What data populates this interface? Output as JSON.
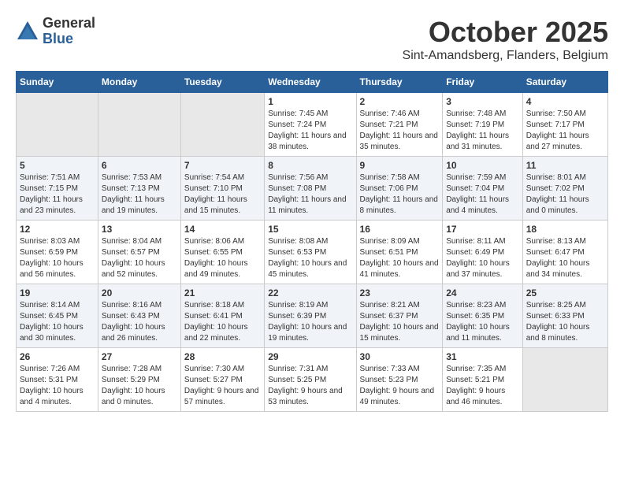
{
  "logo": {
    "general": "General",
    "blue": "Blue"
  },
  "header": {
    "month": "October 2025",
    "location": "Sint-Amandsberg, Flanders, Belgium"
  },
  "weekdays": [
    "Sunday",
    "Monday",
    "Tuesday",
    "Wednesday",
    "Thursday",
    "Friday",
    "Saturday"
  ],
  "weeks": [
    [
      {
        "day": "",
        "empty": true
      },
      {
        "day": "",
        "empty": true
      },
      {
        "day": "",
        "empty": true
      },
      {
        "day": "1",
        "sunrise": "7:45 AM",
        "sunset": "7:24 PM",
        "daylight": "11 hours and 38 minutes."
      },
      {
        "day": "2",
        "sunrise": "7:46 AM",
        "sunset": "7:21 PM",
        "daylight": "11 hours and 35 minutes."
      },
      {
        "day": "3",
        "sunrise": "7:48 AM",
        "sunset": "7:19 PM",
        "daylight": "11 hours and 31 minutes."
      },
      {
        "day": "4",
        "sunrise": "7:50 AM",
        "sunset": "7:17 PM",
        "daylight": "11 hours and 27 minutes."
      }
    ],
    [
      {
        "day": "5",
        "sunrise": "7:51 AM",
        "sunset": "7:15 PM",
        "daylight": "11 hours and 23 minutes."
      },
      {
        "day": "6",
        "sunrise": "7:53 AM",
        "sunset": "7:13 PM",
        "daylight": "11 hours and 19 minutes."
      },
      {
        "day": "7",
        "sunrise": "7:54 AM",
        "sunset": "7:10 PM",
        "daylight": "11 hours and 15 minutes."
      },
      {
        "day": "8",
        "sunrise": "7:56 AM",
        "sunset": "7:08 PM",
        "daylight": "11 hours and 11 minutes."
      },
      {
        "day": "9",
        "sunrise": "7:58 AM",
        "sunset": "7:06 PM",
        "daylight": "11 hours and 8 minutes."
      },
      {
        "day": "10",
        "sunrise": "7:59 AM",
        "sunset": "7:04 PM",
        "daylight": "11 hours and 4 minutes."
      },
      {
        "day": "11",
        "sunrise": "8:01 AM",
        "sunset": "7:02 PM",
        "daylight": "11 hours and 0 minutes."
      }
    ],
    [
      {
        "day": "12",
        "sunrise": "8:03 AM",
        "sunset": "6:59 PM",
        "daylight": "10 hours and 56 minutes."
      },
      {
        "day": "13",
        "sunrise": "8:04 AM",
        "sunset": "6:57 PM",
        "daylight": "10 hours and 52 minutes."
      },
      {
        "day": "14",
        "sunrise": "8:06 AM",
        "sunset": "6:55 PM",
        "daylight": "10 hours and 49 minutes."
      },
      {
        "day": "15",
        "sunrise": "8:08 AM",
        "sunset": "6:53 PM",
        "daylight": "10 hours and 45 minutes."
      },
      {
        "day": "16",
        "sunrise": "8:09 AM",
        "sunset": "6:51 PM",
        "daylight": "10 hours and 41 minutes."
      },
      {
        "day": "17",
        "sunrise": "8:11 AM",
        "sunset": "6:49 PM",
        "daylight": "10 hours and 37 minutes."
      },
      {
        "day": "18",
        "sunrise": "8:13 AM",
        "sunset": "6:47 PM",
        "daylight": "10 hours and 34 minutes."
      }
    ],
    [
      {
        "day": "19",
        "sunrise": "8:14 AM",
        "sunset": "6:45 PM",
        "daylight": "10 hours and 30 minutes."
      },
      {
        "day": "20",
        "sunrise": "8:16 AM",
        "sunset": "6:43 PM",
        "daylight": "10 hours and 26 minutes."
      },
      {
        "day": "21",
        "sunrise": "8:18 AM",
        "sunset": "6:41 PM",
        "daylight": "10 hours and 22 minutes."
      },
      {
        "day": "22",
        "sunrise": "8:19 AM",
        "sunset": "6:39 PM",
        "daylight": "10 hours and 19 minutes."
      },
      {
        "day": "23",
        "sunrise": "8:21 AM",
        "sunset": "6:37 PM",
        "daylight": "10 hours and 15 minutes."
      },
      {
        "day": "24",
        "sunrise": "8:23 AM",
        "sunset": "6:35 PM",
        "daylight": "10 hours and 11 minutes."
      },
      {
        "day": "25",
        "sunrise": "8:25 AM",
        "sunset": "6:33 PM",
        "daylight": "10 hours and 8 minutes."
      }
    ],
    [
      {
        "day": "26",
        "sunrise": "7:26 AM",
        "sunset": "5:31 PM",
        "daylight": "10 hours and 4 minutes."
      },
      {
        "day": "27",
        "sunrise": "7:28 AM",
        "sunset": "5:29 PM",
        "daylight": "10 hours and 0 minutes."
      },
      {
        "day": "28",
        "sunrise": "7:30 AM",
        "sunset": "5:27 PM",
        "daylight": "9 hours and 57 minutes."
      },
      {
        "day": "29",
        "sunrise": "7:31 AM",
        "sunset": "5:25 PM",
        "daylight": "9 hours and 53 minutes."
      },
      {
        "day": "30",
        "sunrise": "7:33 AM",
        "sunset": "5:23 PM",
        "daylight": "9 hours and 49 minutes."
      },
      {
        "day": "31",
        "sunrise": "7:35 AM",
        "sunset": "5:21 PM",
        "daylight": "9 hours and 46 minutes."
      },
      {
        "day": "",
        "empty": true
      }
    ]
  ],
  "labels": {
    "sunrise": "Sunrise:",
    "sunset": "Sunset:",
    "daylight": "Daylight:"
  }
}
